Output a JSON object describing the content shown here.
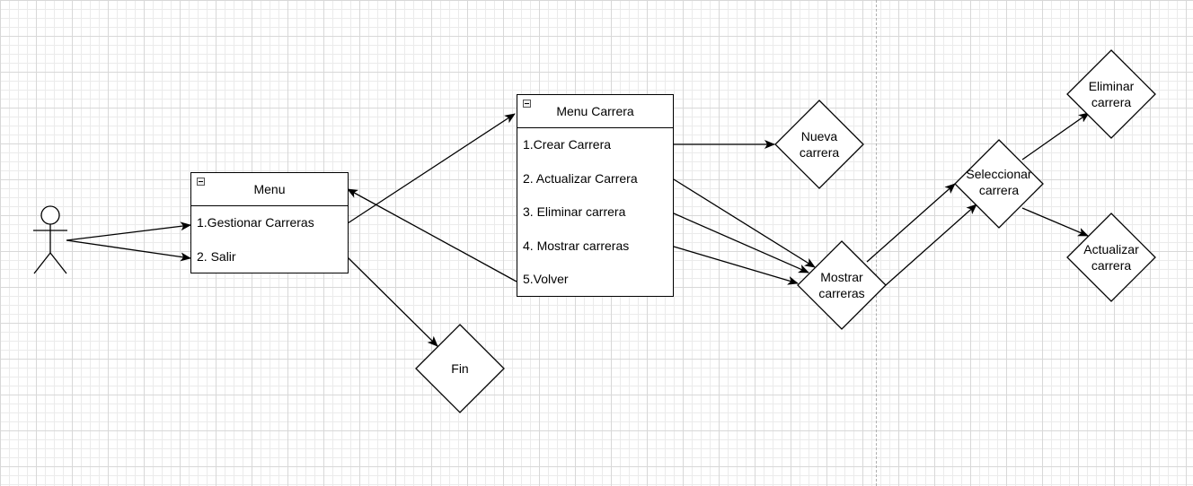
{
  "actor": {
    "icon": "stick-figure-icon"
  },
  "menu": {
    "title": "Menu",
    "items": [
      "1.Gestionar Carreras",
      "2. Salir"
    ]
  },
  "menu_carrera": {
    "title": "Menu Carrera",
    "items": [
      "1.Crear Carrera",
      "2. Actualizar Carrera",
      "3. Eliminar carrera",
      "4. Mostrar carreras",
      "5.Volver"
    ]
  },
  "nodes": {
    "fin": "Fin",
    "nueva_carrera": "Nueva\ncarrera",
    "mostrar_carreras": "Mostrar\ncarreras",
    "seleccionar_carrera": "Seleccionar\ncarrera",
    "eliminar_carrera": "Eliminar\ncarrera",
    "actualizar_carrera": "Actualizar\ncarrera"
  },
  "colors": {
    "stroke": "#000000",
    "grid": "#ebebeb",
    "page_break": "#b0b0b0"
  }
}
